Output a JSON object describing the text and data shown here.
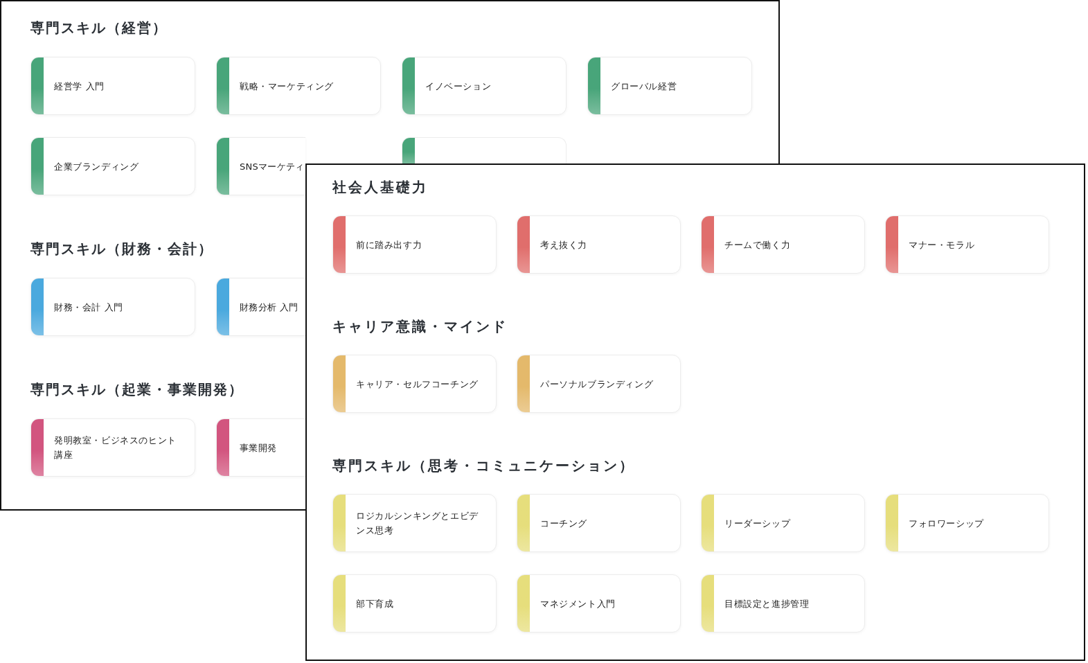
{
  "windows": [
    {
      "sections": [
        {
          "title": "専門スキル（経営）",
          "color": "#48a57a",
          "cards": [
            {
              "kind": "full",
              "label": "経営学 入門"
            },
            {
              "kind": "full",
              "label": "戦略・マーケティング"
            },
            {
              "kind": "full",
              "label": "イノベーション"
            },
            {
              "kind": "full",
              "label": "グローバル経営"
            },
            {
              "kind": "full",
              "label": "企業ブランディング"
            },
            {
              "kind": "cut_right",
              "label": "SNSマーケティ"
            },
            {
              "kind": "cut_bottom"
            }
          ]
        },
        {
          "title": "専門スキル（財務・会計）",
          "color": "#4aa9de",
          "cards": [
            {
              "kind": "full",
              "label": "財務・会計 入門"
            },
            {
              "kind": "cut_right",
              "label": "財務分析 入門"
            }
          ]
        },
        {
          "title": "専門スキル（起業・事業開発）",
          "color": "#d2557f",
          "cards": [
            {
              "kind": "full",
              "label": "発明教室・ビジネスのヒント講座"
            },
            {
              "kind": "cut_right",
              "label": "事業開発"
            }
          ]
        }
      ]
    },
    {
      "sections": [
        {
          "title": "社会人基礎力",
          "color": "#e06e6c",
          "cards": [
            {
              "kind": "full",
              "label": "前に踏み出す力"
            },
            {
              "kind": "full",
              "label": "考え抜く力"
            },
            {
              "kind": "full",
              "label": "チームで働く力"
            },
            {
              "kind": "full",
              "label": "マナー・モラル"
            }
          ]
        },
        {
          "title": "キャリア意識・マインド",
          "color": "#e4b96b",
          "cards": [
            {
              "kind": "full",
              "label": "キャリア・セルフコーチング"
            },
            {
              "kind": "full",
              "label": "パーソナルブランディング"
            }
          ]
        },
        {
          "title": "専門スキル（思考・コミュニケーション）",
          "color": "#e6de7c",
          "cards": [
            {
              "kind": "full",
              "label": "ロジカルシンキングとエビデンス思考"
            },
            {
              "kind": "full",
              "label": "コーチング"
            },
            {
              "kind": "full",
              "label": "リーダーシップ"
            },
            {
              "kind": "full",
              "label": "フォロワーシップ"
            },
            {
              "kind": "full",
              "label": "部下育成"
            },
            {
              "kind": "full",
              "label": "マネジメント入門"
            },
            {
              "kind": "full",
              "label": "目標設定と進捗管理"
            }
          ]
        }
      ]
    }
  ]
}
